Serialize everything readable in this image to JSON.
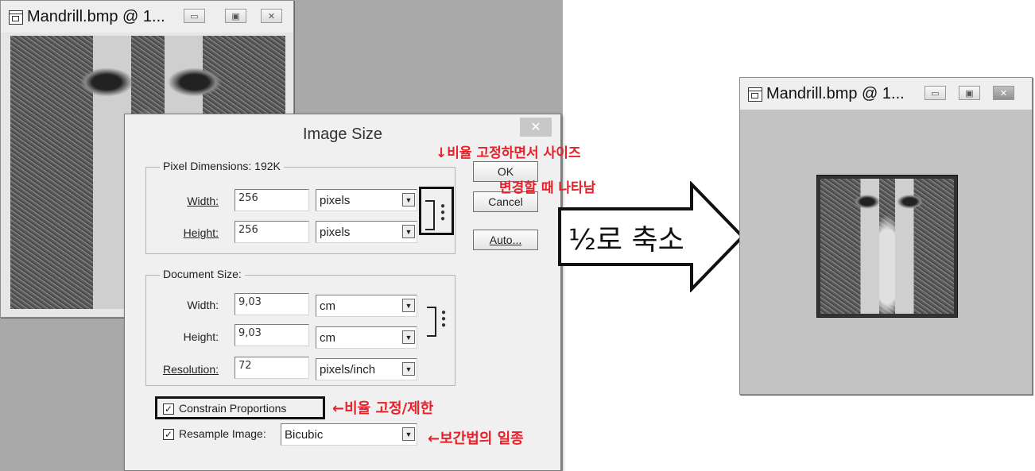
{
  "left_window": {
    "title": "Mandrill.bmp @ 1...",
    "buttons": [
      "▭",
      "▣",
      "✕"
    ]
  },
  "right_window": {
    "title": "Mandrill.bmp @ 1...",
    "buttons": [
      "▭",
      "▣",
      "✕"
    ]
  },
  "dialog": {
    "title": "Image Size",
    "close": "✕",
    "pixel_dimensions": {
      "legend": "Pixel Dimensions:  192K",
      "width_label": "Width:",
      "width_value": "256",
      "width_unit": "pixels",
      "height_label": "Height:",
      "height_value": "256",
      "height_unit": "pixels"
    },
    "document_size": {
      "legend": "Document Size:",
      "width_label": "Width:",
      "width_value": "9,03",
      "width_unit": "cm",
      "height_label": "Height:",
      "height_value": "9,03",
      "height_unit": "cm",
      "resolution_label": "Resolution:",
      "resolution_value": "72",
      "resolution_unit": "pixels/inch"
    },
    "constrain_proportions": {
      "label": "Constrain Proportions",
      "checked": true
    },
    "resample_image": {
      "label": "Resample Image:",
      "checked": true,
      "method": "Bicubic"
    },
    "buttons": {
      "ok": "OK",
      "cancel": "Cancel",
      "auto": "Auto..."
    }
  },
  "annotations": {
    "chain_note_line1": "↓비율 고정하면서 사이즈",
    "chain_note_line2": "변경할 때 나타남",
    "constrain_note": "←비율 고정/제한",
    "resample_note": "←보간법의 일종",
    "arrow_label": "½로 축소"
  },
  "colors": {
    "annotation": "#e8202a",
    "workspace": "#a9a9a9",
    "dialog_bg": "#f0f0f0"
  }
}
